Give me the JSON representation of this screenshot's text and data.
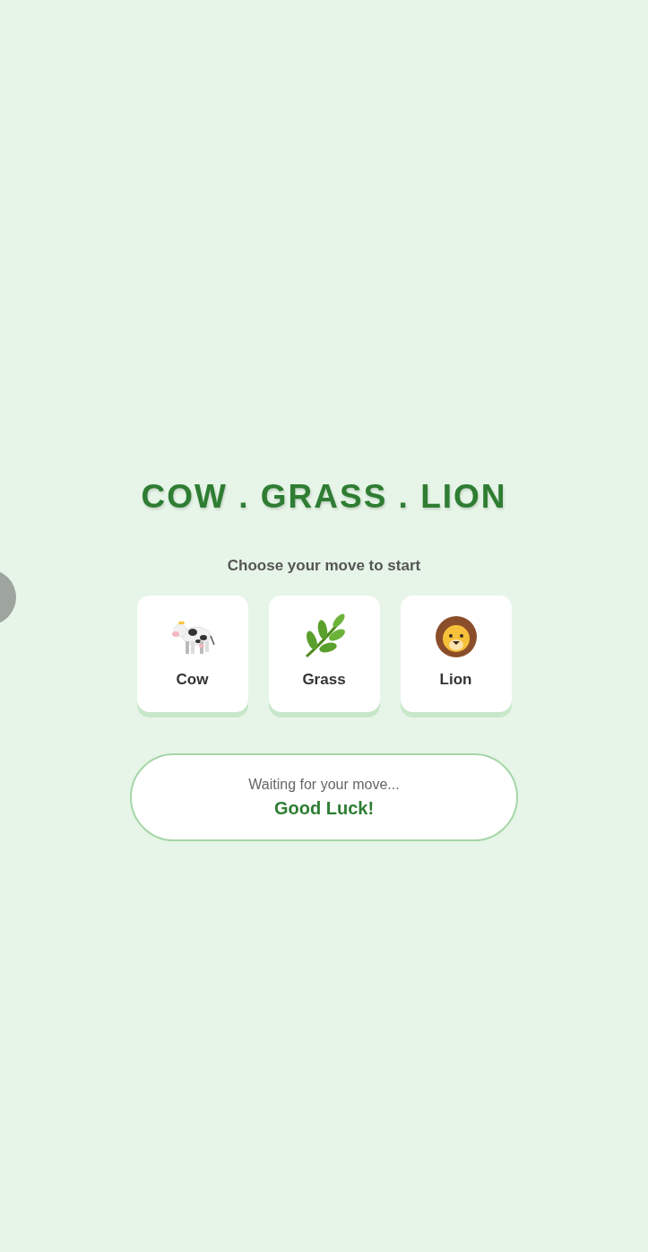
{
  "title": "COW . GRASS . LION",
  "prompt": "Choose your move to start",
  "moves": [
    {
      "kind": "cow",
      "label": "Cow"
    },
    {
      "kind": "grass",
      "label": "Grass"
    },
    {
      "kind": "lion",
      "label": "Lion"
    }
  ],
  "status": {
    "message": "Waiting for your move...",
    "result": "Good Luck!"
  }
}
